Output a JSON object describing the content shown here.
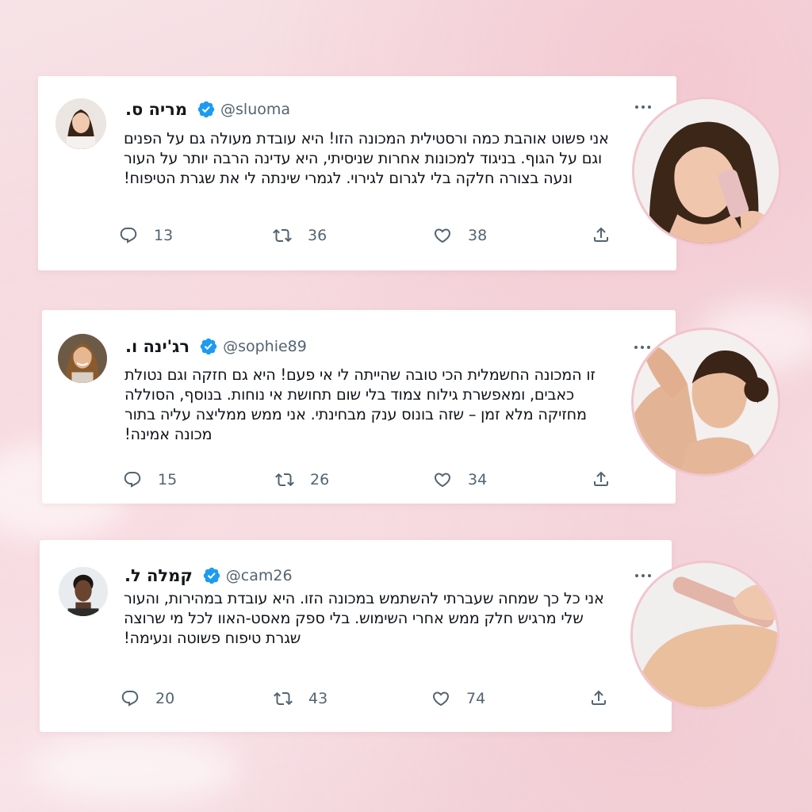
{
  "colors": {
    "accent_verified": "#1d9bf0",
    "text": "#0f1419",
    "muted": "#536471",
    "photo_ring": "#f1c5cd"
  },
  "icons": {
    "reply": "reply-icon",
    "retweet": "retweet-icon",
    "like": "heart-icon",
    "share": "share-icon",
    "more": "more-icon",
    "verified": "verified-badge-icon"
  },
  "tweets": [
    {
      "name": "מריה ס.",
      "handle": "@sluoma",
      "text": "אני פשוט אוהבת כמה ורסטילית המכונה הזו! היא עובדת מעולה גם על הפנים וגם על הגוף. בניגוד למכונות אחרות שניסיתי, היא עדינה הרבה יותר על העור ונעה בצורה חלקה בלי לגרום לגירוי. לגמרי שינתה לי את שגרת הטיפוח!",
      "replies": "13",
      "retweets": "36",
      "likes": "38"
    },
    {
      "name": "רג'ינה ו.",
      "handle": "@sophie89",
      "text": "זו המכונה החשמלית הכי טובה שהייתה לי אי פעם! היא גם חזקה וגם נטולת כאבים, ומאפשרת גילוח צמוד בלי שום תחושת אי נוחות. בנוסף, הסוללה מחזיקה מלא זמן – שזה בונוס ענק מבחינתי. אני ממש ממליצה עליה בתור מכונה אמינה!",
      "replies": "15",
      "retweets": "26",
      "likes": "34"
    },
    {
      "name": "קמלה ל.",
      "handle": "@cam26",
      "text": "אני כל כך שמחה שעברתי להשתמש במכונה הזו. היא עובדת במהירות, והעור שלי מרגיש חלק ממש אחרי השימוש. בלי ספק מאסט-האוו לכל מי שרוצה שגרת טיפוח פשוטה ונעימה!",
      "replies": "20",
      "retweets": "43",
      "likes": "74"
    }
  ]
}
